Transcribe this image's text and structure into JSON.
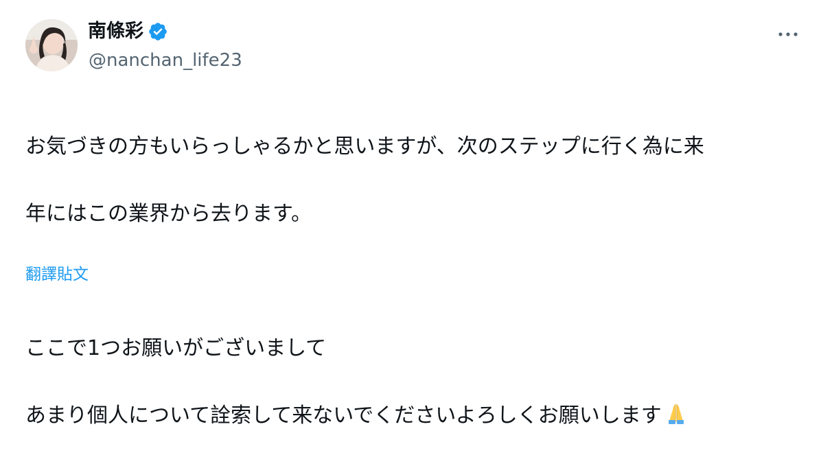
{
  "author": {
    "display_name": "南條彩",
    "handle": "@nanchan_life23",
    "verified": true,
    "verified_color": "#1d9bf0"
  },
  "tweet": {
    "lines": [
      "お気づきの方もいらっしゃるかと思いますが、次のステップに行く為に来",
      "年にはこの業界から去ります。",
      "",
      "ここで1つお願いがございまして",
      "あまり個人について詮索して来ないでくださいよろしくお願いします"
    ],
    "trailing_emoji": "folded-hands"
  },
  "actions": {
    "translate_label": "翻譯貼文",
    "more_icon": "more-horizontal-icon"
  },
  "colors": {
    "text": "#0f1419",
    "secondary": "#536471",
    "link": "#1d9bf0",
    "background": "#ffffff"
  }
}
